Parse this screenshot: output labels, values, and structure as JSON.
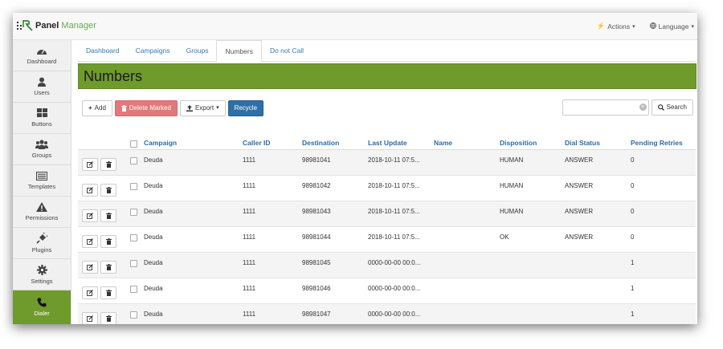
{
  "brand": {
    "name": "Panel",
    "name_accent": "Manager"
  },
  "topbar": {
    "actions_label": "Actions",
    "language_label": "Language"
  },
  "sidebar": {
    "items": [
      {
        "label": "Dashboard",
        "icon": "dashboard-icon"
      },
      {
        "label": "Users",
        "icon": "user-icon"
      },
      {
        "label": "Buttons",
        "icon": "grid-icon"
      },
      {
        "label": "Groups",
        "icon": "users-icon"
      },
      {
        "label": "Templates",
        "icon": "list-icon"
      },
      {
        "label": "Permissions",
        "icon": "warning-icon"
      },
      {
        "label": "Plugins",
        "icon": "plug-icon"
      },
      {
        "label": "Settings",
        "icon": "gear-icon"
      },
      {
        "label": "Dialer",
        "icon": "phone-icon",
        "active": true
      }
    ]
  },
  "tabs": [
    "Dashboard",
    "Campaigns",
    "Groups",
    "Numbers",
    "Do not Call"
  ],
  "active_tab": "Numbers",
  "page_title": "Numbers",
  "toolbar": {
    "add_label": "Add",
    "delete_label": "Delete Marked",
    "export_label": "Export",
    "recycle_label": "Recycle"
  },
  "search": {
    "value": "",
    "placeholder": "",
    "button_label": "Search"
  },
  "table": {
    "headers": [
      "Campaign",
      "Caller ID",
      "Destination",
      "Last Update",
      "Name",
      "Disposition",
      "Dial Status",
      "Pending Retries"
    ],
    "rows": [
      {
        "campaign": "Deuda",
        "caller_id": "1111",
        "destination": "98981041",
        "last_update": "2018-10-11 07:5...",
        "name": "",
        "disposition": "HUMAN",
        "dial_status": "ANSWER",
        "pending": "0"
      },
      {
        "campaign": "Deuda",
        "caller_id": "1111",
        "destination": "98981042",
        "last_update": "2018-10-11 07:5...",
        "name": "",
        "disposition": "HUMAN",
        "dial_status": "ANSWER",
        "pending": "0"
      },
      {
        "campaign": "Deuda",
        "caller_id": "1111",
        "destination": "98981043",
        "last_update": "2018-10-11 07:5...",
        "name": "",
        "disposition": "HUMAN",
        "dial_status": "ANSWER",
        "pending": "0"
      },
      {
        "campaign": "Deuda",
        "caller_id": "1111",
        "destination": "98981044",
        "last_update": "2018-10-11 07:5...",
        "name": "",
        "disposition": "OK",
        "dial_status": "ANSWER",
        "pending": "0"
      },
      {
        "campaign": "Deuda",
        "caller_id": "1111",
        "destination": "98981045",
        "last_update": "0000-00-00 00:0...",
        "name": "",
        "disposition": "",
        "dial_status": "",
        "pending": "1"
      },
      {
        "campaign": "Deuda",
        "caller_id": "1111",
        "destination": "98981046",
        "last_update": "0000-00-00 00:0...",
        "name": "",
        "disposition": "",
        "dial_status": "",
        "pending": "1"
      },
      {
        "campaign": "Deuda",
        "caller_id": "1111",
        "destination": "98981047",
        "last_update": "0000-00-00 00:0...",
        "name": "",
        "disposition": "",
        "dial_status": "",
        "pending": "1"
      }
    ]
  },
  "colors": {
    "accent": "#6e9b2b",
    "link": "#337ab7",
    "danger": "#e3787a",
    "primary": "#2f6fa8"
  }
}
